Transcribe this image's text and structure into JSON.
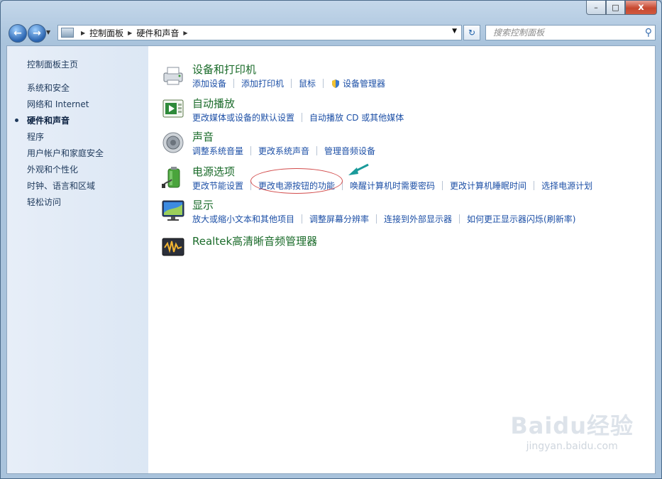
{
  "window": {
    "buttons": {
      "minimize": "–",
      "maximize": "□",
      "close": "x"
    }
  },
  "nav": {
    "back": "←",
    "forward": "→",
    "breadcrumb": [
      "控制面板",
      "硬件和声音"
    ],
    "refresh": "↻",
    "search_placeholder": "搜索控制面板"
  },
  "sidebar": {
    "items": [
      {
        "label": "控制面板主页",
        "active": false
      },
      {
        "label": "系统和安全",
        "active": false
      },
      {
        "label": "网络和 Internet",
        "active": false
      },
      {
        "label": "硬件和声音",
        "active": true
      },
      {
        "label": "程序",
        "active": false
      },
      {
        "label": "用户帐户和家庭安全",
        "active": false
      },
      {
        "label": "外观和个性化",
        "active": false
      },
      {
        "label": "时钟、语言和区域",
        "active": false
      },
      {
        "label": "轻松访问",
        "active": false
      }
    ]
  },
  "categories": [
    {
      "icon": "printer-icon",
      "title": "设备和打印机",
      "links": [
        "添加设备",
        "添加打印机",
        "鼠标",
        "设备管理器"
      ]
    },
    {
      "icon": "autoplay-icon",
      "title": "自动播放",
      "links": [
        "更改媒体或设备的默认设置",
        "自动播放 CD 或其他媒体"
      ]
    },
    {
      "icon": "speaker-icon",
      "title": "声音",
      "links": [
        "调整系统音量",
        "更改系统声音",
        "管理音频设备"
      ]
    },
    {
      "icon": "battery-icon",
      "title": "电源选项",
      "links": [
        "更改节能设置",
        "更改电源按钮的功能",
        "唤醒计算机时需要密码",
        "更改计算机睡眠时间",
        "选择电源计划"
      ]
    },
    {
      "icon": "monitor-icon",
      "title": "显示",
      "links": [
        "放大或缩小文本和其他项目",
        "调整屏幕分辨率",
        "连接到外部显示器",
        "如何更正显示器闪烁(刷新率)"
      ]
    },
    {
      "icon": "audio-manager-icon",
      "title": "Realtek高清晰音频管理器",
      "links": []
    }
  ],
  "watermark": {
    "logo": "Baidu经验",
    "url": "jingyan.baidu.com"
  },
  "colors": {
    "link": "#1c4fa6",
    "category_title": "#1a6b2a",
    "highlight_ellipse": "#d24b4b",
    "arrow": "#1a9a9a"
  }
}
